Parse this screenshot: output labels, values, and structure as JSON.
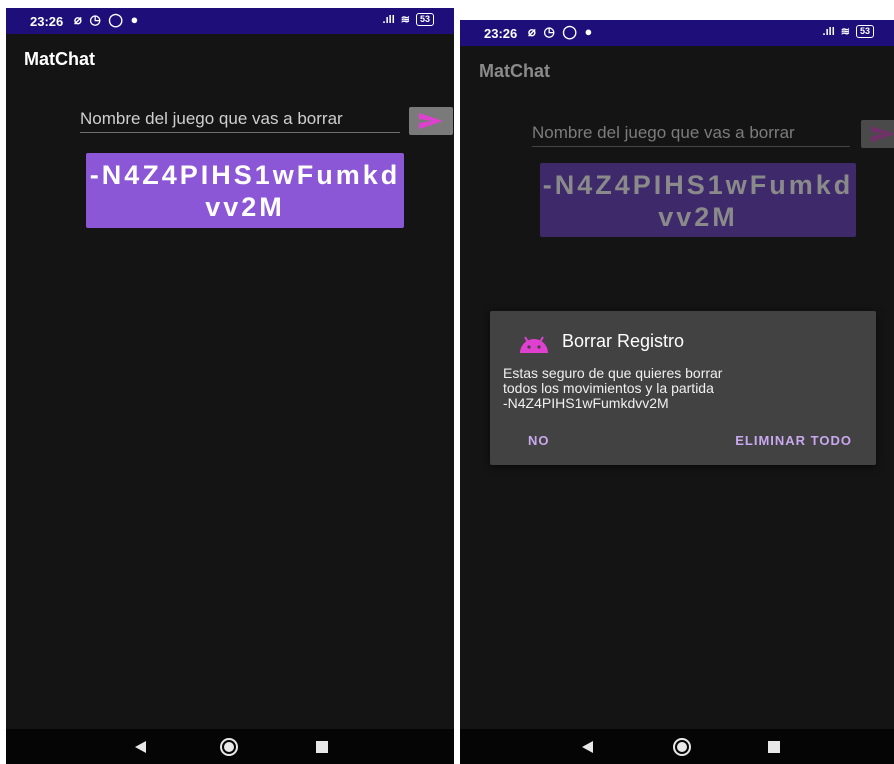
{
  "status_bar": {
    "time": "23:26",
    "battery": "53"
  },
  "app": {
    "title": "MatChat"
  },
  "game_input": {
    "placeholder": "Nombre del juego que vas a borrar",
    "value": ""
  },
  "game_id": {
    "label": "-N4Z4PIHS1wFumkdvv2M"
  },
  "dialog": {
    "title": "Borrar Registro",
    "message_line1": "Estas seguro de que quieres borrar",
    "message_line2": "todos los movimientos y la partida",
    "message_line3": "-N4Z4PIHS1wFumkdvv2M",
    "negative_button": "NO",
    "positive_button": "ELIMINAR TODO"
  },
  "colors": {
    "status_bar": "#1d0e7a",
    "background": "#141414",
    "accent_button": "#8b57d6",
    "send_icon": "#e040d0",
    "dialog_bg": "#424242",
    "dialog_button_text": "#c9a8f0",
    "android_icon": "#e040d0"
  },
  "icons": {
    "send": "send-icon",
    "android": "android-icon",
    "back": "nav-back-icon",
    "home": "nav-home-icon",
    "recents": "nav-recents-icon"
  }
}
